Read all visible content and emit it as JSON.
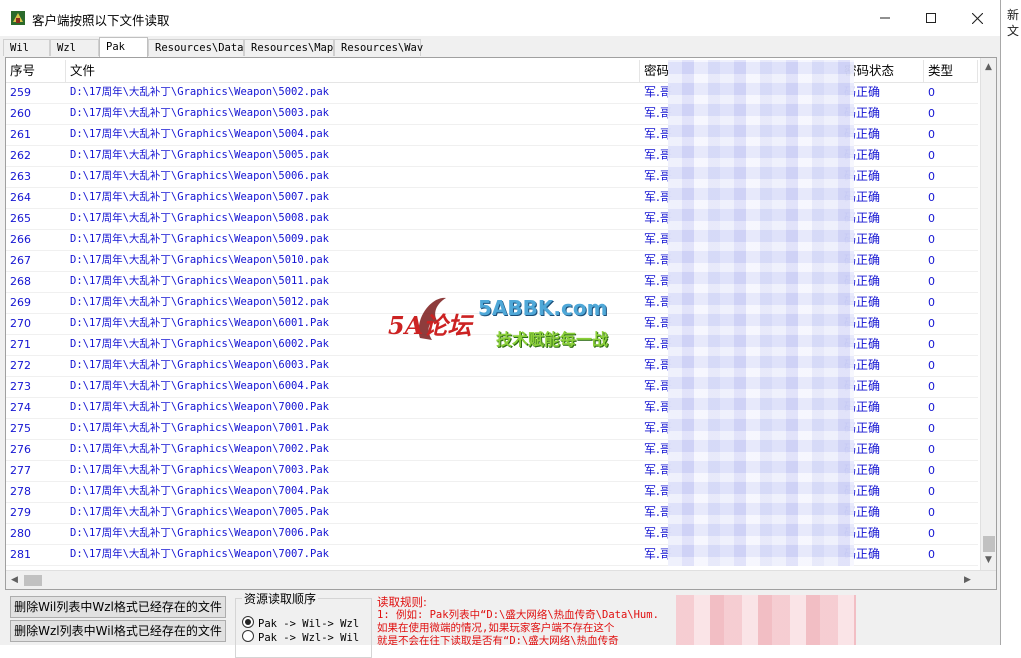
{
  "window": {
    "title": "客户端按照以下文件读取"
  },
  "background_right": {
    "texts": [
      "新",
      "文"
    ]
  },
  "tabs": [
    {
      "label": "Wil",
      "active": false
    },
    {
      "label": "Wzl",
      "active": false
    },
    {
      "label": "Pak",
      "active": true
    },
    {
      "label": "Resources\\Data",
      "active": false
    },
    {
      "label": "Resources\\Map",
      "active": false
    },
    {
      "label": "Resources\\Wav",
      "active": false
    }
  ],
  "list": {
    "headers": {
      "index": "序号",
      "file": "文件",
      "password": "密码",
      "status": "密码状态",
      "type": "类型"
    },
    "rows": [
      {
        "index": "259",
        "file": "D:\\17周年\\大乱补丁\\Graphics\\Weapon\\5002.pak",
        "password": "军.哥",
        "status": "码正确",
        "type": "0"
      },
      {
        "index": "260",
        "file": "D:\\17周年\\大乱补丁\\Graphics\\Weapon\\5003.pak",
        "password": "军.哥",
        "status": "码正确",
        "type": "0"
      },
      {
        "index": "261",
        "file": "D:\\17周年\\大乱补丁\\Graphics\\Weapon\\5004.pak",
        "password": "军.哥",
        "status": "码正确",
        "type": "0"
      },
      {
        "index": "262",
        "file": "D:\\17周年\\大乱补丁\\Graphics\\Weapon\\5005.pak",
        "password": "军.哥",
        "status": "码正确",
        "type": "0"
      },
      {
        "index": "263",
        "file": "D:\\17周年\\大乱补丁\\Graphics\\Weapon\\5006.pak",
        "password": "军.哥",
        "status": "码正确",
        "type": "0"
      },
      {
        "index": "264",
        "file": "D:\\17周年\\大乱补丁\\Graphics\\Weapon\\5007.pak",
        "password": "军.哥",
        "status": "码正确",
        "type": "0"
      },
      {
        "index": "265",
        "file": "D:\\17周年\\大乱补丁\\Graphics\\Weapon\\5008.pak",
        "password": "军.哥",
        "status": "码正确",
        "type": "0"
      },
      {
        "index": "266",
        "file": "D:\\17周年\\大乱补丁\\Graphics\\Weapon\\5009.pak",
        "password": "军.哥",
        "status": "码正确",
        "type": "0"
      },
      {
        "index": "267",
        "file": "D:\\17周年\\大乱补丁\\Graphics\\Weapon\\5010.pak",
        "password": "军.哥",
        "status": "码正确",
        "type": "0"
      },
      {
        "index": "268",
        "file": "D:\\17周年\\大乱补丁\\Graphics\\Weapon\\5011.pak",
        "password": "军.哥",
        "status": "码正确",
        "type": "0"
      },
      {
        "index": "269",
        "file": "D:\\17周年\\大乱补丁\\Graphics\\Weapon\\5012.pak",
        "password": "军.哥",
        "status": "码正确",
        "type": "0"
      },
      {
        "index": "270",
        "file": "D:\\17周年\\大乱补丁\\Graphics\\Weapon\\6001.Pak",
        "password": "军.哥",
        "status": "码正确",
        "type": "0"
      },
      {
        "index": "271",
        "file": "D:\\17周年\\大乱补丁\\Graphics\\Weapon\\6002.Pak",
        "password": "军.哥",
        "status": "码正确",
        "type": "0"
      },
      {
        "index": "272",
        "file": "D:\\17周年\\大乱补丁\\Graphics\\Weapon\\6003.Pak",
        "password": "军.哥",
        "status": "码正确",
        "type": "0"
      },
      {
        "index": "273",
        "file": "D:\\17周年\\大乱补丁\\Graphics\\Weapon\\6004.Pak",
        "password": "军.哥",
        "status": "码正确",
        "type": "0"
      },
      {
        "index": "274",
        "file": "D:\\17周年\\大乱补丁\\Graphics\\Weapon\\7000.Pak",
        "password": "军.哥",
        "status": "码正确",
        "type": "0"
      },
      {
        "index": "275",
        "file": "D:\\17周年\\大乱补丁\\Graphics\\Weapon\\7001.Pak",
        "password": "军.哥",
        "status": "码正确",
        "type": "0"
      },
      {
        "index": "276",
        "file": "D:\\17周年\\大乱补丁\\Graphics\\Weapon\\7002.Pak",
        "password": "军.哥",
        "status": "码正确",
        "type": "0"
      },
      {
        "index": "277",
        "file": "D:\\17周年\\大乱补丁\\Graphics\\Weapon\\7003.Pak",
        "password": "军.哥",
        "status": "码正确",
        "type": "0"
      },
      {
        "index": "278",
        "file": "D:\\17周年\\大乱补丁\\Graphics\\Weapon\\7004.Pak",
        "password": "军.哥",
        "status": "码正确",
        "type": "0"
      },
      {
        "index": "279",
        "file": "D:\\17周年\\大乱补丁\\Graphics\\Weapon\\7005.Pak",
        "password": "军.哥",
        "status": "码正确",
        "type": "0"
      },
      {
        "index": "280",
        "file": "D:\\17周年\\大乱补丁\\Graphics\\Weapon\\7006.Pak",
        "password": "军.哥",
        "status": "码正确",
        "type": "0"
      },
      {
        "index": "281",
        "file": "D:\\17周年\\大乱补丁\\Graphics\\Weapon\\7007.Pak",
        "password": "军.哥",
        "status": "码正确",
        "type": "0"
      }
    ]
  },
  "watermark": {
    "brand": "5A论坛",
    "site": "5ABBK.com",
    "slogan": "技术赋能每一战"
  },
  "buttons": {
    "delete_wil": "删除Wil列表中Wzl格式已经存在的文件",
    "delete_wzl": "删除Wzl列表中Wil格式已经存在的文件"
  },
  "read_order": {
    "label": "资源读取顺序",
    "options": [
      {
        "label": "Pak -> Wil-> Wzl",
        "checked": true
      },
      {
        "label": "Pak -> Wzl-> Wil",
        "checked": false
      }
    ]
  },
  "rules": {
    "title": "读取规则:",
    "lines": [
      "1: 例如: Pak列表中“D:\\盛大网络\\热血传奇\\Data\\Hum.",
      "   如果在使用微端的情况,如果玩家客户端不存在这个",
      "   就是不会在往下读取是否有“D:\\盛大网络\\热血传奇"
    ]
  },
  "colors": {
    "link_blue": "#1414d2",
    "rule_red": "#e01010"
  }
}
